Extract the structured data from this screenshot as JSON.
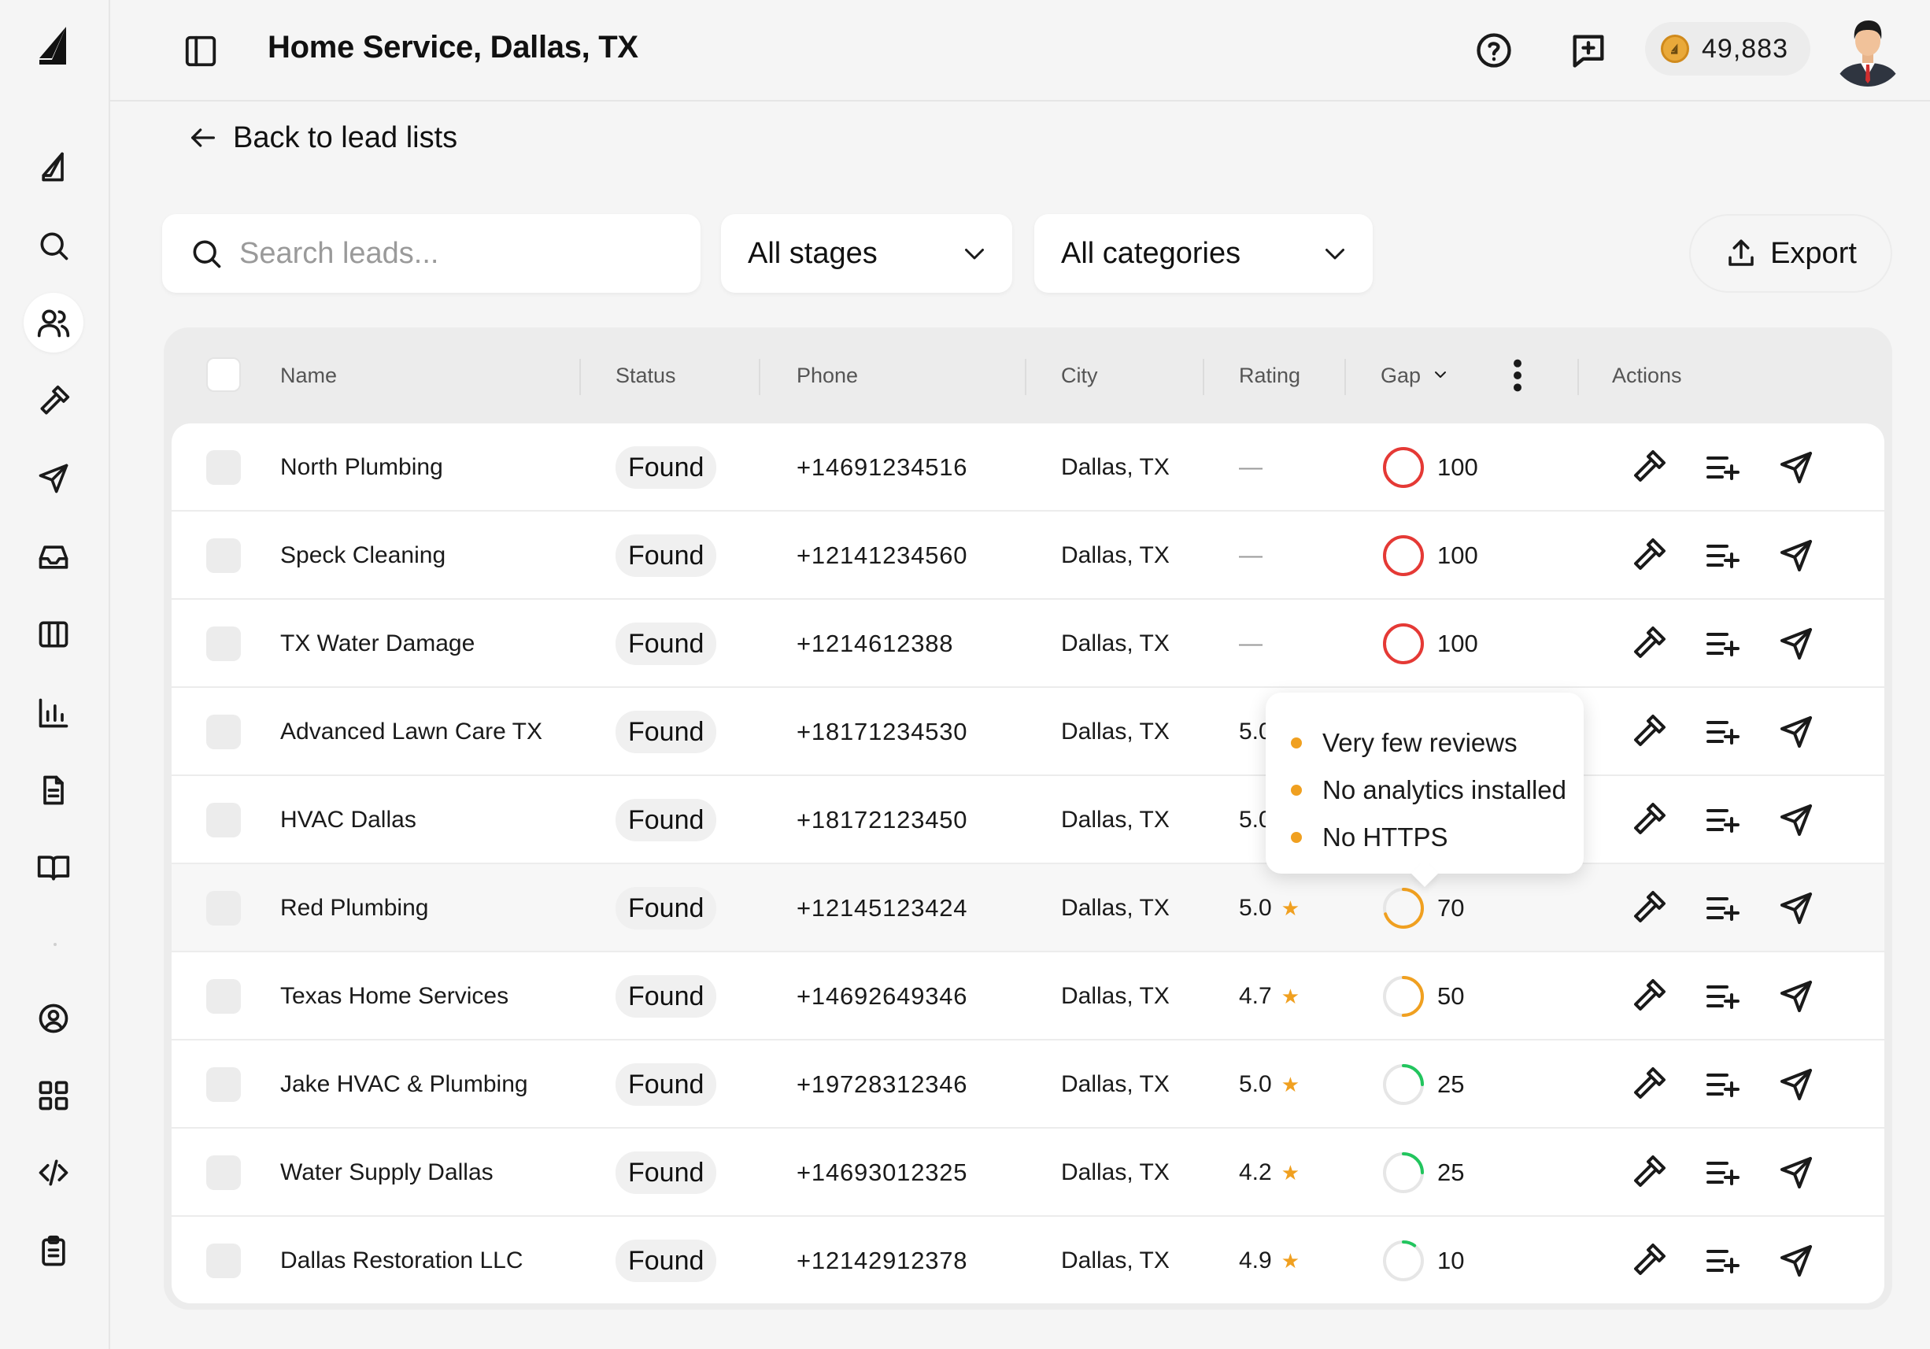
{
  "header": {
    "title": "Home Service, Dallas, TX",
    "credits": "49,883"
  },
  "sidebar": {
    "items": [
      {
        "name": "leads-icon-rocket"
      },
      {
        "name": "search-icon"
      },
      {
        "name": "users-icon"
      },
      {
        "name": "hammer-icon"
      },
      {
        "name": "send-icon"
      },
      {
        "name": "inbox-icon"
      },
      {
        "name": "columns-icon"
      },
      {
        "name": "bar-chart-icon"
      },
      {
        "name": "document-icon"
      },
      {
        "name": "book-icon"
      },
      {
        "name": "user-circle-icon"
      },
      {
        "name": "grid-icon"
      },
      {
        "name": "code-icon"
      },
      {
        "name": "clipboard-icon"
      }
    ],
    "active_index": 2
  },
  "back_link": "Back to lead lists",
  "filters": {
    "search_placeholder": "Search leads...",
    "stage": "All stages",
    "category": "All categories",
    "export_label": "Export"
  },
  "table": {
    "columns": {
      "name": "Name",
      "status": "Status",
      "phone": "Phone",
      "city": "City",
      "rating": "Rating",
      "gap": "Gap",
      "actions": "Actions"
    },
    "rows": [
      {
        "name": "North Plumbing",
        "status": "Found",
        "phone": "+14691234516",
        "city": "Dallas, TX",
        "rating": "—",
        "gap": "100",
        "gap_value": 100
      },
      {
        "name": "Speck Cleaning",
        "status": "Found",
        "phone": "+12141234560",
        "city": "Dallas, TX",
        "rating": "—",
        "gap": "100",
        "gap_value": 100
      },
      {
        "name": "TX Water Damage",
        "status": "Found",
        "phone": "+1214612388",
        "city": "Dallas, TX",
        "rating": "—",
        "gap": "100",
        "gap_value": 100
      },
      {
        "name": "Advanced Lawn Care TX",
        "status": "Found",
        "phone": "+18171234530",
        "city": "Dallas, TX",
        "rating": "5.0",
        "gap": "",
        "gap_value": 0
      },
      {
        "name": "HVAC Dallas",
        "status": "Found",
        "phone": "+18172123450",
        "city": "Dallas, TX",
        "rating": "5.0",
        "gap": "",
        "gap_value": 0
      },
      {
        "name": "Red Plumbing",
        "status": "Found",
        "phone": "+12145123424",
        "city": "Dallas, TX",
        "rating": "5.0",
        "gap": "70",
        "gap_value": 70
      },
      {
        "name": "Texas Home Services",
        "status": "Found",
        "phone": "+14692649346",
        "city": "Dallas, TX",
        "rating": "4.7",
        "gap": "50",
        "gap_value": 50
      },
      {
        "name": "Jake HVAC & Plumbing",
        "status": "Found",
        "phone": "+19728312346",
        "city": "Dallas, TX",
        "rating": "5.0",
        "gap": "25",
        "gap_value": 25
      },
      {
        "name": "Water Supply Dallas",
        "status": "Found",
        "phone": "+14693012325",
        "city": "Dallas, TX",
        "rating": "4.2",
        "gap": "25",
        "gap_value": 25
      },
      {
        "name": "Dallas Restoration LLC",
        "status": "Found",
        "phone": "+12142912378",
        "city": "Dallas, TX",
        "rating": "4.9",
        "gap": "10",
        "gap_value": 10
      }
    ],
    "hover_row": 5
  },
  "tooltip": {
    "items": [
      "Very few reviews",
      "No analytics installed",
      "No HTTPS"
    ]
  },
  "colors": {
    "gap_high": "#e53935",
    "gap_mid": "#f0a020",
    "gap_low": "#22c55e",
    "ring_track": "#e6e6e6",
    "star": "#f0a020"
  }
}
